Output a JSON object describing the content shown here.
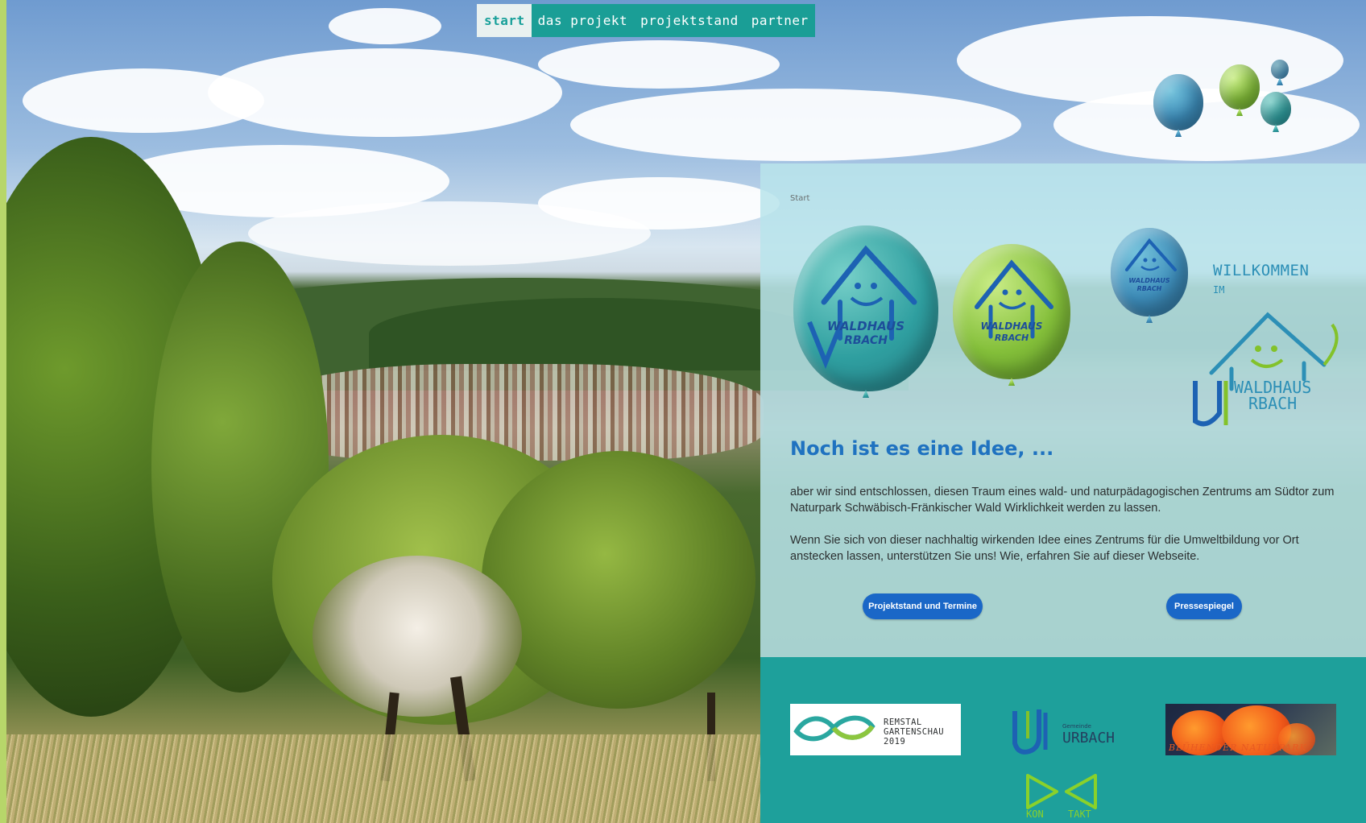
{
  "nav": {
    "items": [
      {
        "label": "start",
        "active": true
      },
      {
        "label": "das projekt",
        "active": false
      },
      {
        "label": "projektstand",
        "active": false
      },
      {
        "label": "partner",
        "active": false
      }
    ]
  },
  "balloon_logo": {
    "word1": "WALDHAUS",
    "word2": "RBACH"
  },
  "breadcrumb": "Start",
  "welcome": {
    "line1": "WILLKOMMEN",
    "line2": "IM",
    "name1": "WALDHAUS",
    "name2": "RBACH"
  },
  "content": {
    "headline": "Noch ist es eine Idee, ...",
    "paragraph1": "aber wir sind entschlossen, diesen Traum eines wald- und naturpädagogischen Zentrums am Südtor zum Naturpark Schwäbisch-Fränkischer Wald Wirklichkeit werden zu lassen.",
    "paragraph2": "Wenn Sie sich von dieser nachhaltig wirkenden Idee eines Zentrums für die Umweltbildung vor Ort anstecken lassen, unterstützen Sie uns!  Wie, erfahren Sie auf dieser Webseite.",
    "button_projekt": "Projektstand und Termine",
    "button_presse": "Pressespiegel"
  },
  "footer": {
    "remstal": {
      "line1": "REMSTAL",
      "line2": "GARTENSCHAU",
      "line3": "2019"
    },
    "urbach": {
      "small": "Gemeinde",
      "big": "URBACH"
    },
    "bluehend": "BLÜHENDER NATURPARK",
    "kontakt": {
      "part1": "KON",
      "part2": "TAKT"
    }
  },
  "colors": {
    "nav_bg": "#1a9e96",
    "nav_active_bg": "#e9f1f0",
    "panel_bg": "#b9e4eb",
    "headline": "#1f72c0",
    "button": "#1a67c7",
    "footer_bg": "#1ea09b",
    "side_strip": "#b7d66a"
  }
}
